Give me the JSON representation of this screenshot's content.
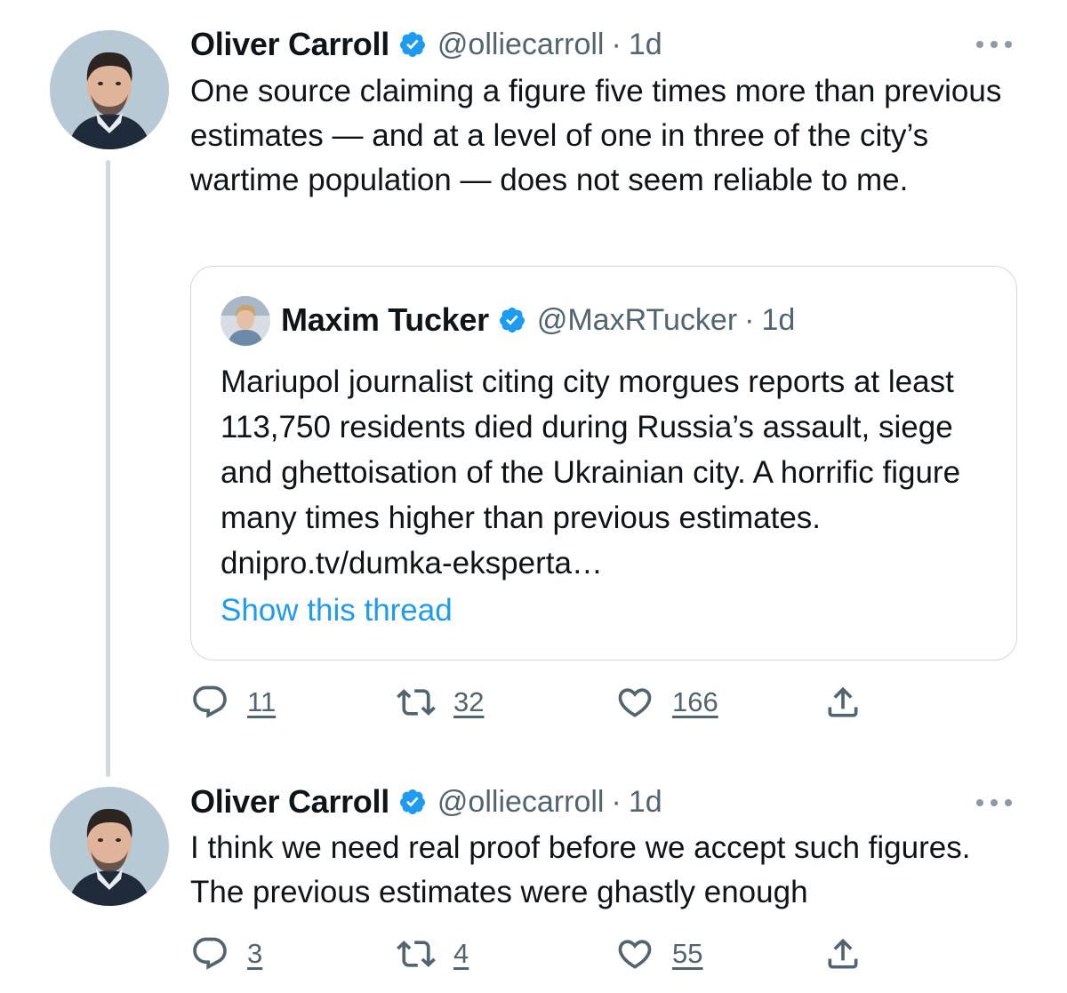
{
  "thread": [
    {
      "author": {
        "name": "Oliver Carroll",
        "handle": "@olliecarroll",
        "time": "1d",
        "verified": true
      },
      "text": "One source claiming a figure five times more than previous estimates — and at a level of one in three of the city’s wartime population — does not seem reliable to me.",
      "quoted_tweet": {
        "author": {
          "name": "Maxim Tucker",
          "handle": "@MaxRTucker",
          "time": "1d",
          "verified": true
        },
        "text": "Mariupol journalist citing city morgues reports at least 113,750 residents died during Russia’s assault, siege and ghettoisation of the Ukrainian city. A horrific figure many times higher than previous estimates. dnipro.tv/dumka-eksperta…",
        "show_thread_label": "Show this thread"
      },
      "stats": {
        "replies": "11",
        "retweets": "32",
        "likes": "166"
      }
    },
    {
      "author": {
        "name": "Oliver Carroll",
        "handle": "@olliecarroll",
        "time": "1d",
        "verified": true
      },
      "text": "I think we need real proof before we accept such figures. The previous estimates were ghastly enough",
      "stats": {
        "replies": "3",
        "retweets": "4",
        "likes": "55"
      }
    }
  ],
  "meta_separator": "·",
  "colors": {
    "text": "#0f1419",
    "secondary": "#536471",
    "accent": "#1d9bf0",
    "border": "#cfd9de"
  },
  "icons": {
    "verified": "verified-badge-icon",
    "more": "more-dots-icon",
    "reply": "reply-icon",
    "retweet": "retweet-icon",
    "like": "heart-icon",
    "share": "share-icon"
  }
}
